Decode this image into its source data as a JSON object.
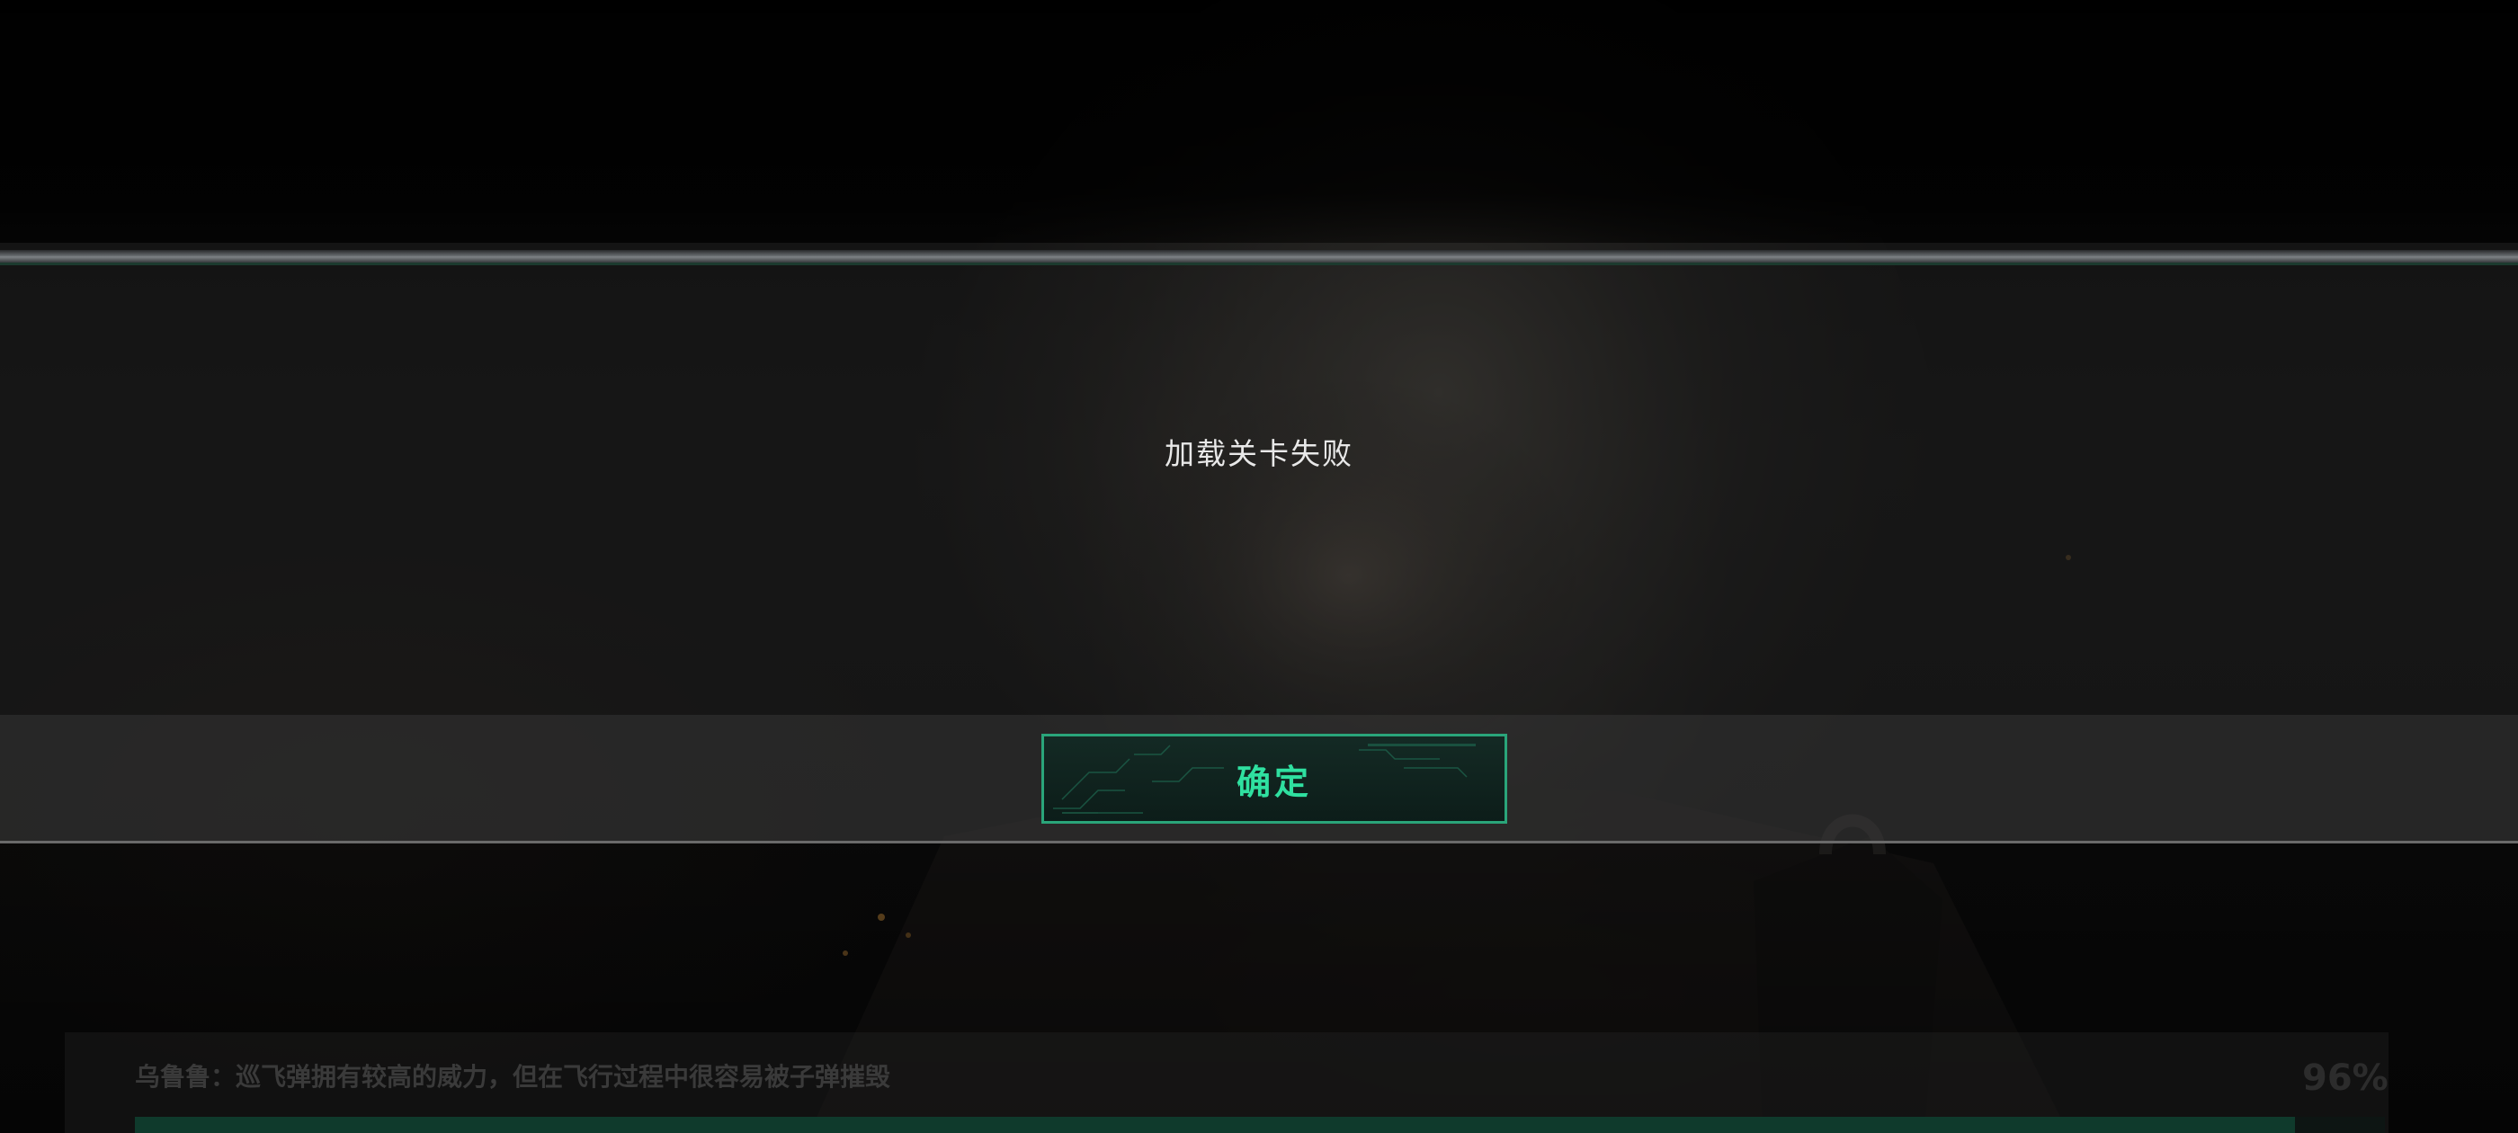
{
  "dialog": {
    "message": "加载关卡失败",
    "confirm_label": "确定"
  },
  "loading": {
    "tip": "乌鲁鲁：巡飞弹拥有较高的威力，但在飞行过程中很容易被子弹摧毁",
    "percent_text": "96%",
    "progress": 0.96
  },
  "colors": {
    "accent": "#2fe0a0",
    "button_border": "#2aa57a",
    "message_text": "#e8e8e8"
  },
  "icons": {
    "background": "character-portrait-art"
  }
}
